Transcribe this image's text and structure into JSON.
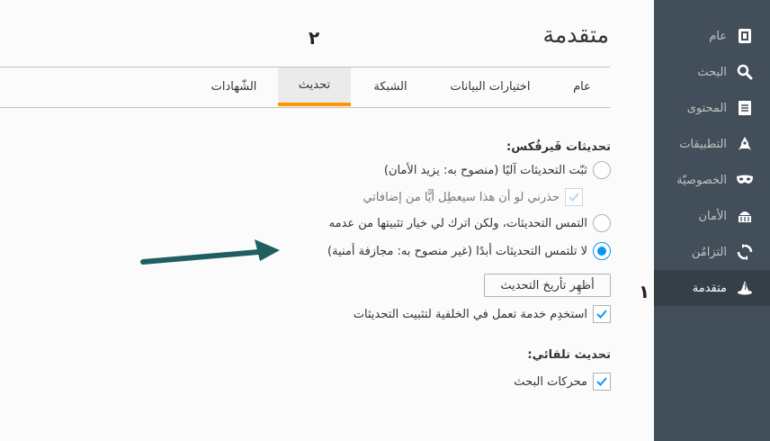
{
  "page_title": "متقدمة",
  "annotations": {
    "marker_1": "١",
    "marker_2": "٢"
  },
  "sidebar": {
    "items": [
      {
        "label": "عام",
        "icon": "general-icon"
      },
      {
        "label": "البحث",
        "icon": "search-icon"
      },
      {
        "label": "المحتوى",
        "icon": "content-icon"
      },
      {
        "label": "التطبيقات",
        "icon": "applications-icon"
      },
      {
        "label": "الخصوصيّة",
        "icon": "privacy-mask-icon"
      },
      {
        "label": "الأمان",
        "icon": "security-icon"
      },
      {
        "label": "التزامُن",
        "icon": "sync-icon"
      },
      {
        "label": "متقدمة",
        "icon": "advanced-wizard-hat-icon",
        "selected": true
      }
    ]
  },
  "tabs": [
    {
      "label": "عام"
    },
    {
      "label": "اختيارات البيانات"
    },
    {
      "label": "الشبكة"
    },
    {
      "label": "تحديث",
      "selected": true
    },
    {
      "label": "الشّهادات"
    }
  ],
  "updates_section": {
    "heading": "تحديثات فَيرفُكس:",
    "option_auto": "ثبّت التحديثات آليًا (منصوح به: يزيد الأمان)",
    "option_warn_addons": "حذرني لو أن هذا سيعطِل أيًّا من إضافاتي",
    "option_ask": "التمس التحديثات، ولكن اترك لي خيار تثبيتها من عدمه",
    "option_never": "لا تلتمس التحديثات أبدًا (غير منصوح به: مجازفة أمنية)",
    "history_button": "أظهِر تأريخ التحديث",
    "background_service": "استخدِم خدمة تعمل في الخلفية لتثبيت التحديثات"
  },
  "auto_update_section": {
    "heading": "تحديث تلقائي:",
    "search_engines": "محركات البحث"
  },
  "colors": {
    "sidebar_bg": "#424f5a",
    "sidebar_selected": "#343f48",
    "tab_accent": "#ff9500",
    "check_blue": "#0996f8",
    "arrow": "#1f5f60"
  }
}
